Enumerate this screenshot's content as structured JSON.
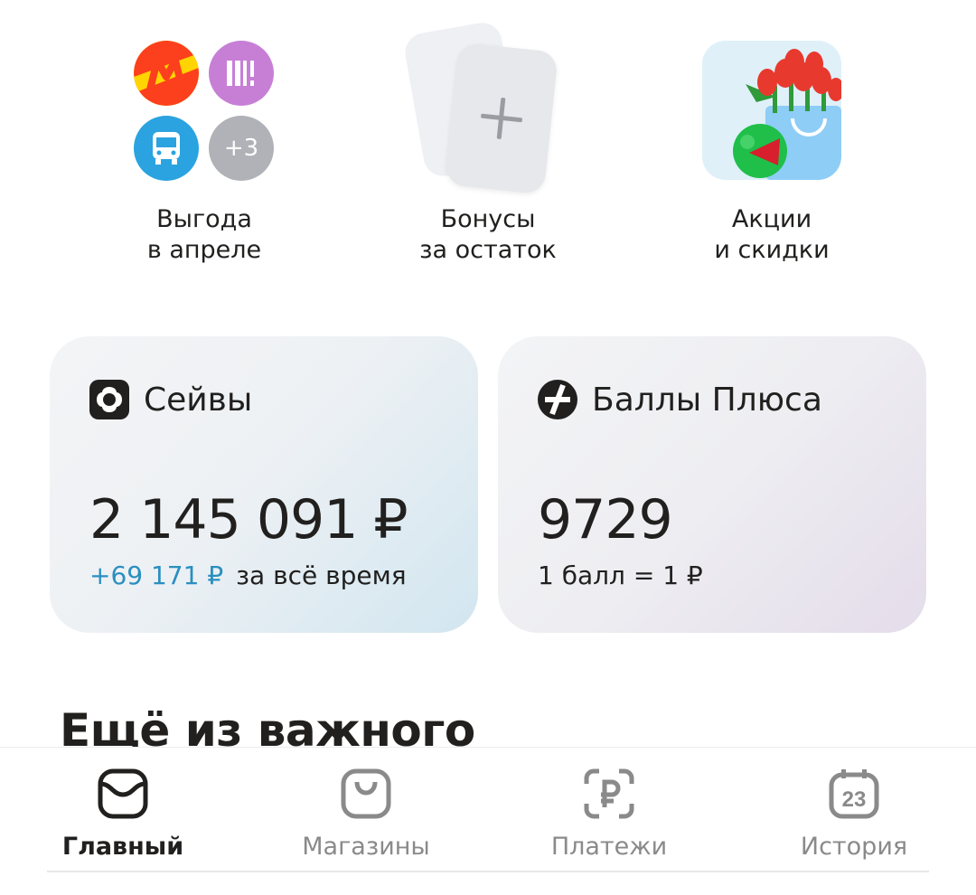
{
  "quick_actions": [
    {
      "label_line1": "Выгода",
      "label_line2": "в апреле",
      "more_badge": "+3"
    },
    {
      "label_line1": "Бонусы",
      "label_line2": "за остаток"
    },
    {
      "label_line1": "Акции",
      "label_line2": "и скидки"
    }
  ],
  "saves_card": {
    "title": "Сейвы",
    "amount": "2 145 091 ₽",
    "delta": "+69 171 ₽",
    "delta_caption": "за всё время",
    "accent_color": "#2a8fc0"
  },
  "plus_card": {
    "title": "Баллы Плюса",
    "points": "9729",
    "rate": "1 балл = 1 ₽"
  },
  "section": {
    "title": "Ещё из важного"
  },
  "tabbar": {
    "tabs": [
      {
        "label": "Главный",
        "icon": "wallet-icon",
        "active": true
      },
      {
        "label": "Магазины",
        "icon": "shopping-bag-icon",
        "active": false
      },
      {
        "label": "Платежи",
        "icon": "ruble-scan-icon",
        "active": false
      },
      {
        "label": "История",
        "icon": "calendar-icon",
        "active": false
      }
    ],
    "calendar_day": "23"
  }
}
